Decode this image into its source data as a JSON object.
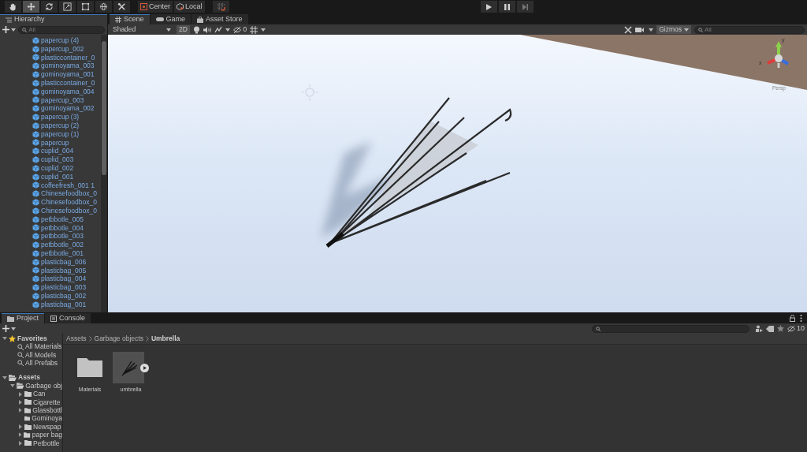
{
  "toolbar": {
    "tools": [
      {
        "kind": "hand",
        "selected": false
      },
      {
        "kind": "move",
        "selected": true
      },
      {
        "kind": "rotate",
        "selected": false
      },
      {
        "kind": "scale",
        "selected": false
      },
      {
        "kind": "rect",
        "selected": false
      },
      {
        "kind": "transform",
        "selected": false
      },
      {
        "kind": "custom",
        "selected": false
      }
    ],
    "pivot": [
      "Center",
      "Local"
    ]
  },
  "hierarchy": {
    "title": "Hierarchy",
    "search_placeholder": "All",
    "items": [
      "papercup (4)",
      "papercup_002",
      "plasticcontainer_0",
      "gominoyama_003",
      "gominoyama_001",
      "plasticcontainer_0",
      "gominoyama_004",
      "papercup_003",
      "gominoyama_002",
      "papercup (3)",
      "papercup (2)",
      "papercup (1)",
      "papercup",
      "cuplid_004",
      "cuplid_003",
      "cuplid_002",
      "cuplid_001",
      "coffeefresh_001 1",
      "Chinesefoodbox_0",
      "Chinesefoodbox_0",
      "Chinesefoodbox_0",
      "petbbotle_005",
      "petbbotle_004",
      "petbbotle_003",
      "petbbotle_002",
      "petbbotle_001",
      "plasticbag_006",
      "plasticbag_005",
      "plasticbag_004",
      "plasticbag_003",
      "plasticbag_002",
      "plasticbag_001"
    ]
  },
  "scene_tabs": [
    {
      "label": "Scene",
      "kind": "scene",
      "selected": true
    },
    {
      "label": "Game",
      "kind": "game",
      "selected": false
    },
    {
      "label": "Asset Store",
      "kind": "store",
      "selected": false
    }
  ],
  "scene_toolbar": {
    "shading": "Shaded",
    "mode_2d": "2D",
    "hidden_count": "0",
    "gizmos": "Gizmos",
    "search_placeholder": "All"
  },
  "gizmo": {
    "x_label": "x",
    "y_label": "y",
    "projection": "Persp"
  },
  "bottom_tabs": [
    {
      "label": "Project",
      "kind": "project",
      "selected": true
    },
    {
      "label": "Console",
      "kind": "console",
      "selected": false
    }
  ],
  "project": {
    "hidden_count": "10",
    "favorites": {
      "label": "Favorites",
      "items": [
        "All Materials",
        "All Models",
        "All Prefabs"
      ]
    },
    "assets": {
      "label": "Assets",
      "expanded": true,
      "children": [
        {
          "label": "Garbage obj",
          "expanded": true,
          "children": [
            {
              "label": "Can",
              "expandable": true
            },
            {
              "label": "Cigarette",
              "expandable": true
            },
            {
              "label": "Glassbottl",
              "expandable": true
            },
            {
              "label": "Gominoya",
              "expandable": false
            },
            {
              "label": "Newspap",
              "expandable": true
            },
            {
              "label": "paper bag",
              "expandable": true
            },
            {
              "label": "Petbottle",
              "expandable": true
            }
          ]
        }
      ]
    },
    "breadcrumb": [
      "Assets",
      "Garbage objects",
      "Umbrella"
    ],
    "files": [
      {
        "name": "Materials",
        "kind": "folder"
      },
      {
        "name": "umbrella",
        "kind": "model"
      }
    ]
  }
}
